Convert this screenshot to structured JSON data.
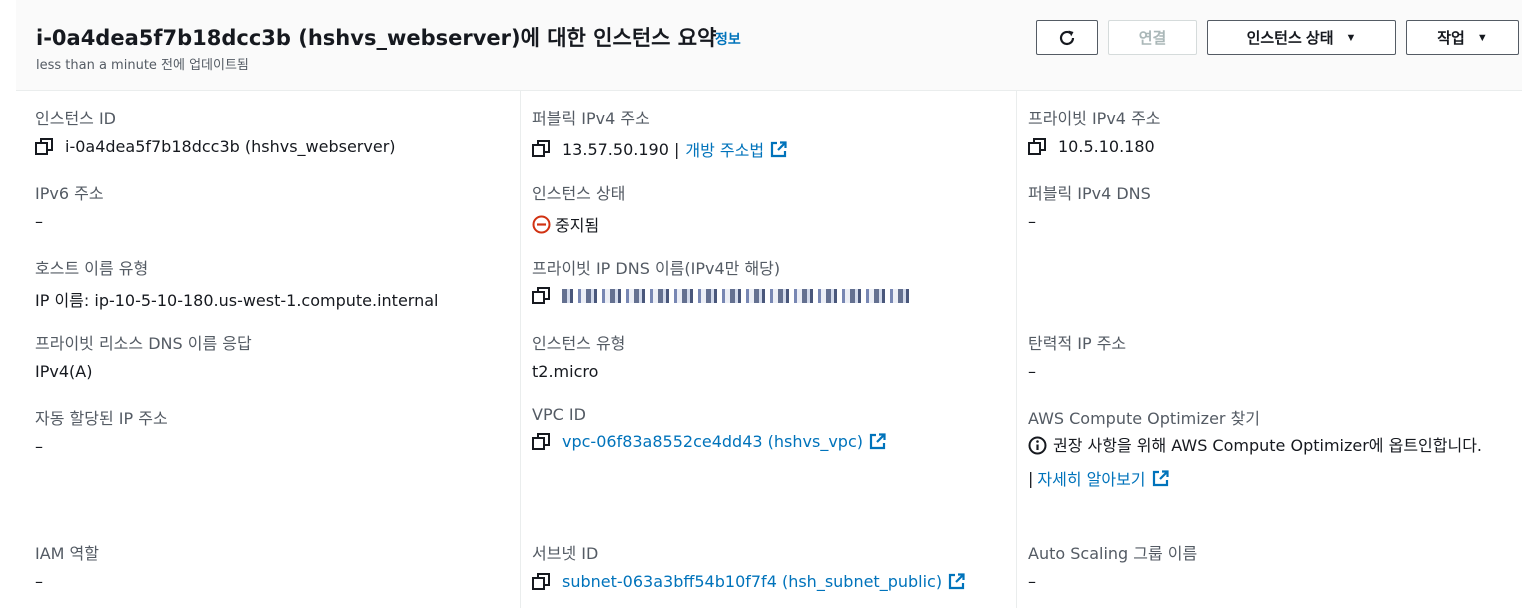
{
  "header": {
    "title": "i-0a4dea5f7b18dcc3b (hshvs_webserver)에 대한 인스턴스 요약",
    "info_link": "정보",
    "updated": "less than a minute 전에 업데이트됨",
    "buttons": {
      "connect": "연결",
      "instance_state": "인스턴스 상태",
      "actions": "작업"
    }
  },
  "fields": {
    "instance_id": {
      "label": "인스턴스 ID",
      "value": "i-0a4dea5f7b18dcc3b (hshvs_webserver)"
    },
    "public_ipv4": {
      "label": "퍼블릭 IPv4 주소",
      "value": "13.57.50.190 |",
      "link": "개방 주소법"
    },
    "private_ipv4": {
      "label": "프라이빗 IPv4 주소",
      "value": "10.5.10.180"
    },
    "ipv6": {
      "label": "IPv6 주소",
      "value": "–"
    },
    "instance_state": {
      "label": "인스턴스 상태",
      "value": "중지됨"
    },
    "public_ipv4_dns": {
      "label": "퍼블릭 IPv4 DNS",
      "value": "–"
    },
    "hostname_type": {
      "label": "호스트 이름 유형",
      "value": "IP 이름: ip-10-5-10-180.us-west-1.compute.internal"
    },
    "private_ip_dns": {
      "label": "프라이빗 IP DNS 이름(IPv4만 해당)"
    },
    "private_dns_answer": {
      "label": "프라이빗 리소스 DNS 이름 응답",
      "value": "IPv4(A)"
    },
    "instance_type": {
      "label": "인스턴스 유형",
      "value": "t2.micro"
    },
    "elastic_ip": {
      "label": "탄력적 IP 주소",
      "value": "–"
    },
    "auto_ip": {
      "label": "자동 할당된 IP 주소",
      "value": "–"
    },
    "vpc_id": {
      "label": "VPC ID",
      "value": "vpc-06f83a8552ce4dd43 (hshvs_vpc)"
    },
    "optimizer": {
      "label": "AWS Compute Optimizer 찾기",
      "text": "권장 사항을 위해 AWS Compute Optimizer에 옵트인합니다.",
      "prefix": "|",
      "link": "자세히 알아보기"
    },
    "iam_role": {
      "label": "IAM 역할",
      "value": "–"
    },
    "subnet_id": {
      "label": "서브넷 ID",
      "value": "subnet-063a3bff54b10f7f4 (hsh_subnet_public)"
    },
    "asg_name": {
      "label": "Auto Scaling 그룹 이름",
      "value": "–"
    }
  },
  "colors": {
    "link": "#0073bb",
    "stopped": "#d13212",
    "label": "#545b64",
    "text": "#16191f"
  },
  "icons": [
    "refresh-icon",
    "copy-icon",
    "external-link-icon",
    "stop-icon",
    "info-circle-icon",
    "caret-down-icon"
  ]
}
